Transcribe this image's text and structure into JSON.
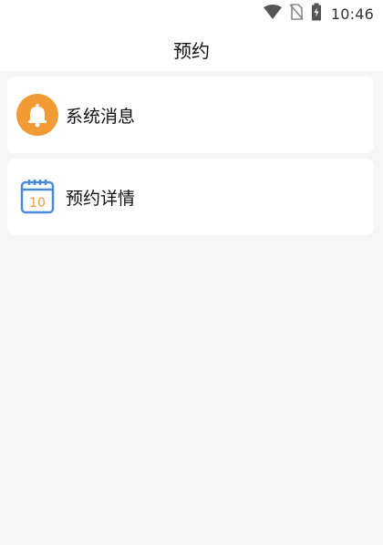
{
  "status_bar": {
    "time": "10:46",
    "icons": [
      "wifi-icon",
      "no-sim-icon",
      "battery-charging-icon"
    ]
  },
  "header": {
    "title": "预约"
  },
  "list": {
    "items": [
      {
        "label": "系统消息",
        "icon": "bell-icon",
        "icon_color": "#F29A35"
      },
      {
        "label": "预约详情",
        "icon": "calendar-icon",
        "icon_color": "#4A8BE0",
        "icon_text": "10",
        "icon_text_color": "#F29A35"
      }
    ]
  }
}
